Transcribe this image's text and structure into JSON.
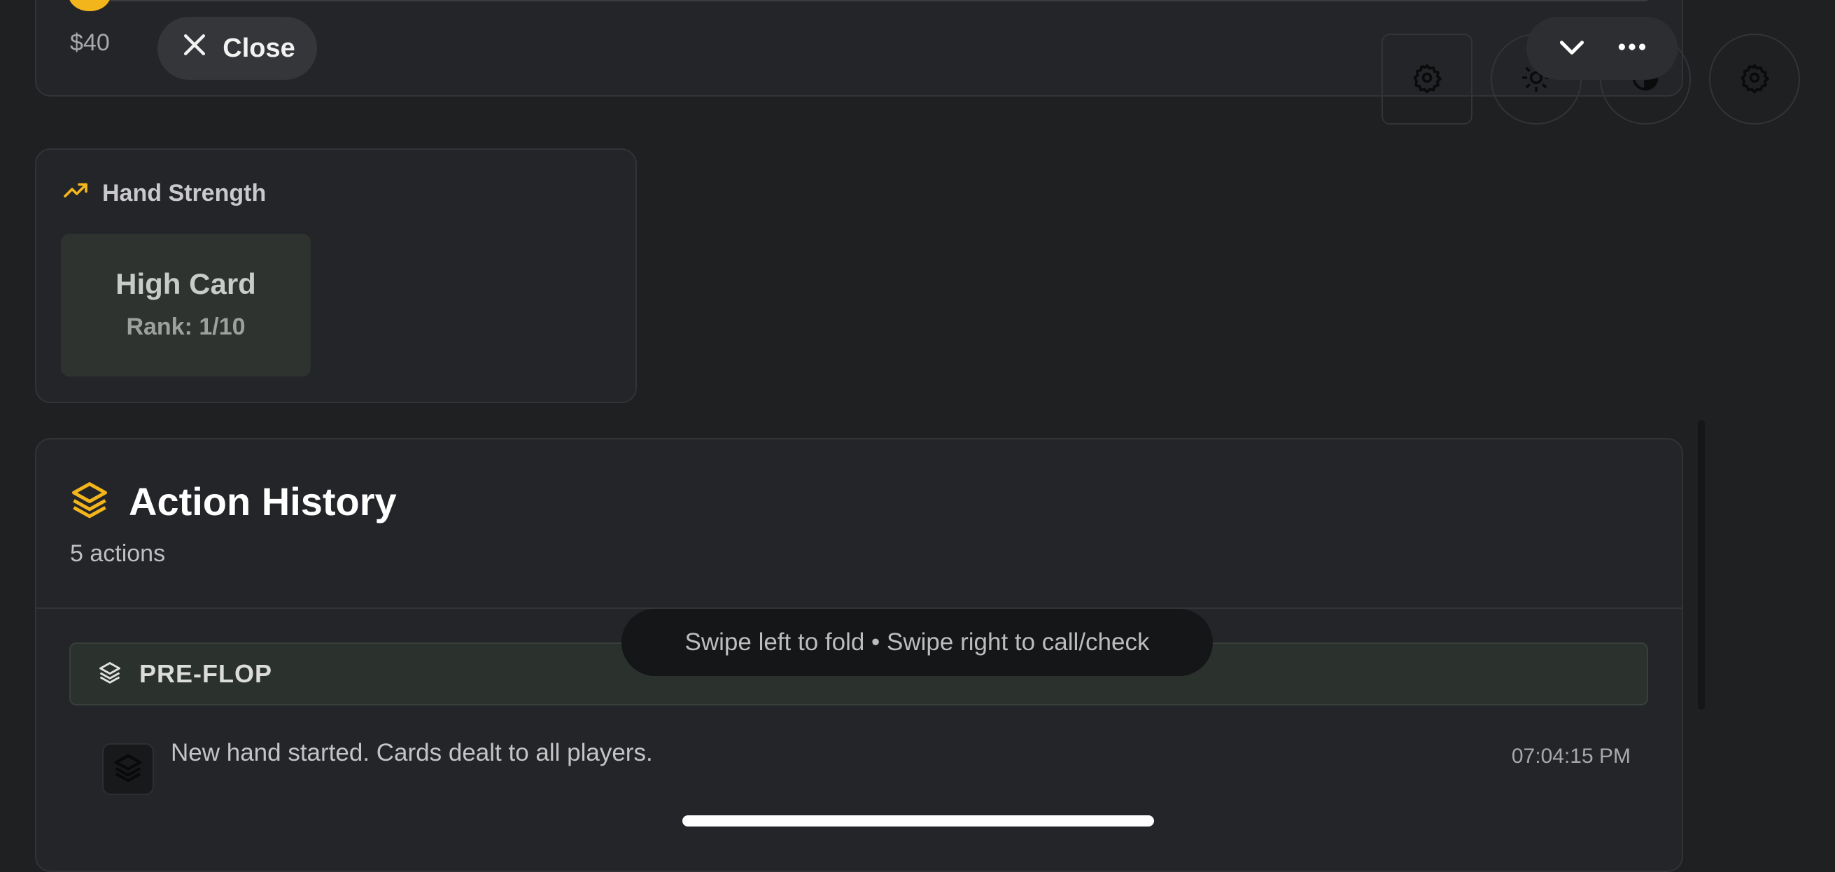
{
  "bet_slider": {
    "min_label": "$40"
  },
  "close_button": {
    "label": "Close"
  },
  "hand_strength": {
    "title": "Hand Strength",
    "hand": "High Card",
    "rank": "Rank: 1/10"
  },
  "action_history": {
    "title": "Action History",
    "count": "5 actions",
    "stage": "PRE-FLOP",
    "entries": [
      {
        "text": "New hand started. Cards dealt to all players.",
        "time": "07:04:15 PM"
      }
    ]
  },
  "toast": "Swipe left to fold • Swipe right to call/check",
  "colors": {
    "accent": "#f3b51c",
    "background": "#1f2022",
    "card": "#242528"
  },
  "icons": [
    "close-icon",
    "gear-icon",
    "sun-icon",
    "contrast-icon",
    "chevron-down-icon",
    "more-horizontal-icon",
    "trending-up-icon",
    "layers-icon"
  ]
}
